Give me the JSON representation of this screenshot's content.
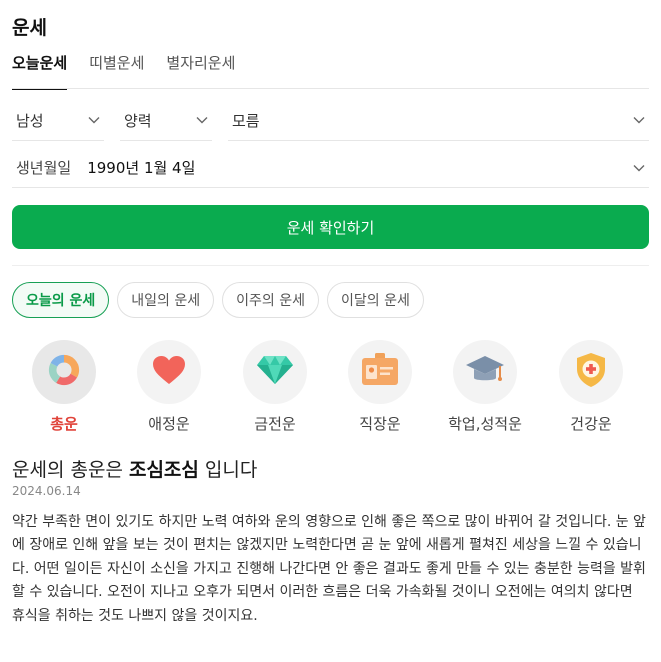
{
  "header": {
    "title": "운세"
  },
  "tabs": [
    {
      "label": "오늘운세",
      "active": true
    },
    {
      "label": "띠별운세",
      "active": false
    },
    {
      "label": "별자리운세",
      "active": false
    }
  ],
  "selects": {
    "gender": "남성",
    "calendar": "양력",
    "birth_time": "모름"
  },
  "birth": {
    "label": "생년월일",
    "value": "1990년 1월 4일"
  },
  "cta": {
    "label": "운세 확인하기"
  },
  "period_chips": [
    {
      "label": "오늘의 운세",
      "active": true
    },
    {
      "label": "내일의 운세",
      "active": false
    },
    {
      "label": "이주의 운세",
      "active": false
    },
    {
      "label": "이달의 운세",
      "active": false
    }
  ],
  "categories": [
    {
      "label": "총운",
      "icon": "donut-chart-icon",
      "active": true
    },
    {
      "label": "애정운",
      "icon": "heart-icon",
      "active": false
    },
    {
      "label": "금전운",
      "icon": "diamond-icon",
      "active": false
    },
    {
      "label": "직장운",
      "icon": "id-badge-icon",
      "active": false
    },
    {
      "label": "학업,성적운",
      "icon": "graduation-cap-icon",
      "active": false
    },
    {
      "label": "건강운",
      "icon": "health-shield-icon",
      "active": false
    }
  ],
  "result": {
    "prefix": "운세의 총운은 ",
    "keyword": "조심조심",
    "suffix": " 입니다",
    "date": "2024.06.14",
    "text": "약간 부족한 면이 있기도 하지만 노력 여하와 운의 영향으로 인해 좋은 쪽으로 많이 바뀌어 갈 것입니다. 눈 앞에 장애로 인해 앞을 보는 것이 편치는 않겠지만 노력한다면 곧 눈 앞에 새롭게 펼쳐진 세상을 느낄 수 있습니다. 어떤 일이든 자신이 소신을 가지고 진행해 나간다면 안 좋은 결과도 좋게 만들 수 있는 충분한 능력을 발휘할 수 있습니다. 오전이 지나고 오후가 되면서 이러한 흐름은 더욱 가속화될 것이니 오전에는 여의치 않다면 휴식을 취하는 것도 나쁘지 않을 것이지요."
  },
  "colors": {
    "accent_green": "#0aab4f",
    "active_red": "#e0433a"
  }
}
